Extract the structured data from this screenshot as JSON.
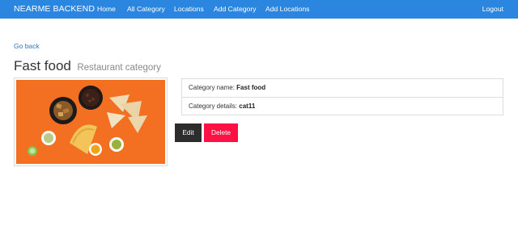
{
  "navbar": {
    "brand": "NEARME BACKEND",
    "links": [
      "Home",
      "All Category",
      "Locations",
      "Add Category",
      "Add Locations"
    ],
    "logout": "Logout",
    "color": "#2b86e0"
  },
  "go_back": "Go back",
  "page": {
    "title": "Fast food",
    "subtitle": "Restaurant category"
  },
  "image": {
    "icon": "fast-food-photo"
  },
  "details": {
    "name_label": "Category name:",
    "name_value": "Fast food",
    "details_label": "Category details:",
    "details_value": "cat11"
  },
  "actions": {
    "edit": "Edit",
    "delete": "Delete",
    "delete_color": "#ff1144"
  }
}
